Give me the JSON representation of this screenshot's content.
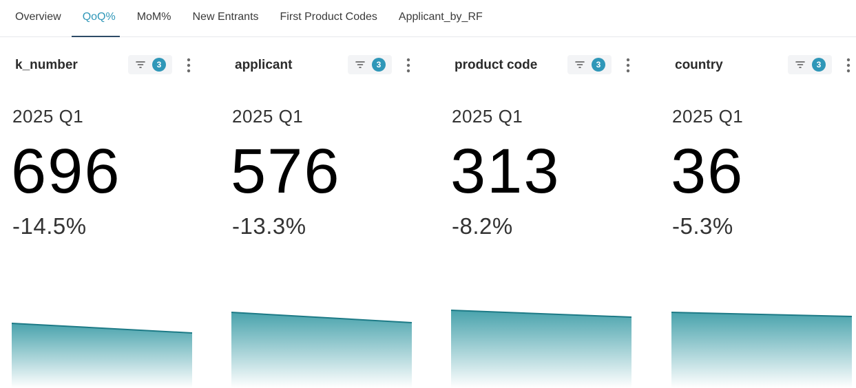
{
  "tabs": [
    {
      "label": "Overview",
      "active": false
    },
    {
      "label": "QoQ%",
      "active": true
    },
    {
      "label": "MoM%",
      "active": false
    },
    {
      "label": "New Entrants",
      "active": false
    },
    {
      "label": "First Product Codes",
      "active": false
    },
    {
      "label": "Applicant_by_RF",
      "active": false
    }
  ],
  "cards": [
    {
      "title": "k_number",
      "filter_count": "3",
      "period": "2025 Q1",
      "value": "696",
      "change": "-14.5%"
    },
    {
      "title": "applicant",
      "filter_count": "3",
      "period": "2025 Q1",
      "value": "576",
      "change": "-13.3%"
    },
    {
      "title": "product code",
      "filter_count": "3",
      "period": "2025 Q1",
      "value": "313",
      "change": "-8.2%"
    },
    {
      "title": "country",
      "filter_count": "3",
      "period": "2025 Q1",
      "value": "36",
      "change": "-5.3%"
    }
  ],
  "colors": {
    "accent": "#2f97b8",
    "tab_underline": "#2d4a66",
    "spark_line": "#1d7a86",
    "spark_fill": "#3f9ea8"
  },
  "icons": {
    "filter": "filter-icon",
    "menu": "more-vertical-icon"
  }
}
